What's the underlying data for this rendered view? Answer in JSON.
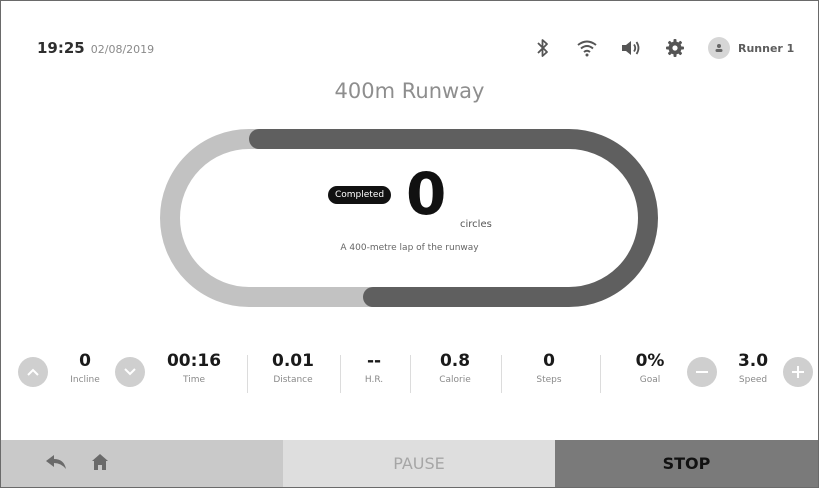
{
  "status": {
    "time": "19:25",
    "date": "02/08/2019",
    "icons": [
      "bluetooth-icon",
      "wifi-icon",
      "volume-icon",
      "settings-icon"
    ],
    "user_name": "Runner 1"
  },
  "title": "400m Runway",
  "laps": {
    "badge": "Completed",
    "value": "0",
    "unit": "circles",
    "description": "A 400-metre lap of the runway"
  },
  "metrics": [
    {
      "value": "0",
      "label": "Incline"
    },
    {
      "value": "00:16",
      "label": "Time"
    },
    {
      "value": "0.01",
      "label": "Distance"
    },
    {
      "value": "--",
      "label": "H.R."
    },
    {
      "value": "0.8",
      "label": "Calorie"
    },
    {
      "value": "0",
      "label": "Steps"
    },
    {
      "value": "0%",
      "label": "Goal"
    },
    {
      "value": "3.0",
      "label": "Speed"
    }
  ],
  "buttons": {
    "pause": "PAUSE",
    "stop": "STOP"
  },
  "colors": {
    "track_done": "#5f5f5f",
    "track_remaining": "#c2c2c2",
    "stop_bg": "#7a7a7a"
  }
}
